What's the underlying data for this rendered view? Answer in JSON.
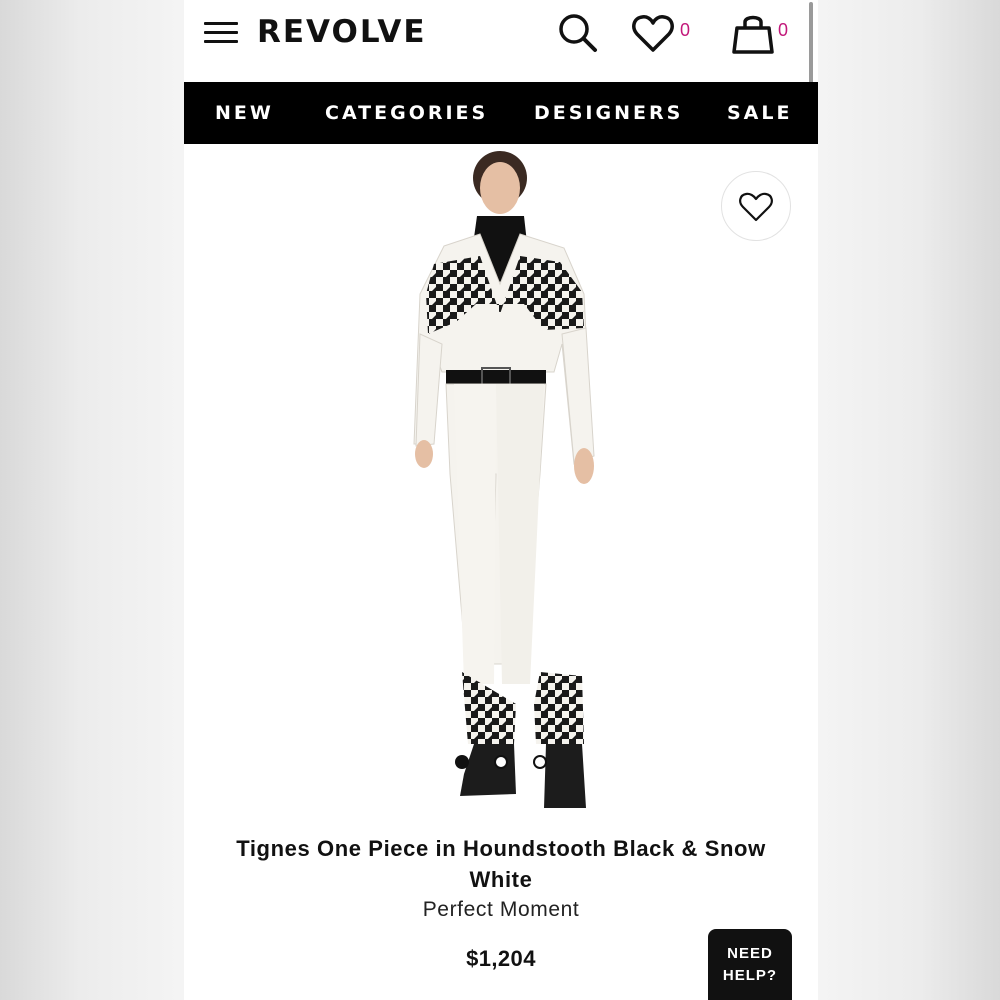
{
  "header": {
    "logo": "REVOLVE",
    "wishlist_count": "0",
    "cart_count": "0",
    "icons": [
      "menu-icon",
      "search-icon",
      "heart-icon",
      "bag-icon"
    ]
  },
  "nav": {
    "items": [
      {
        "label": "NEW"
      },
      {
        "label": "CATEGORIES"
      },
      {
        "label": "DESIGNERS"
      },
      {
        "label": "SALE"
      }
    ]
  },
  "product": {
    "image_alt": "Model wearing white ski jumpsuit with black houndstooth panels",
    "image_count": 3,
    "active_image": 1,
    "title_line1": "Tignes One Piece in Houndstooth Black & Snow",
    "title_line2": "White",
    "designer": "Perfect Moment",
    "price": "$1,204"
  },
  "help": {
    "line1": "NEED",
    "line2": "HELP?"
  },
  "colors": {
    "accent": "#c2187a",
    "nav_bg": "#000000"
  }
}
